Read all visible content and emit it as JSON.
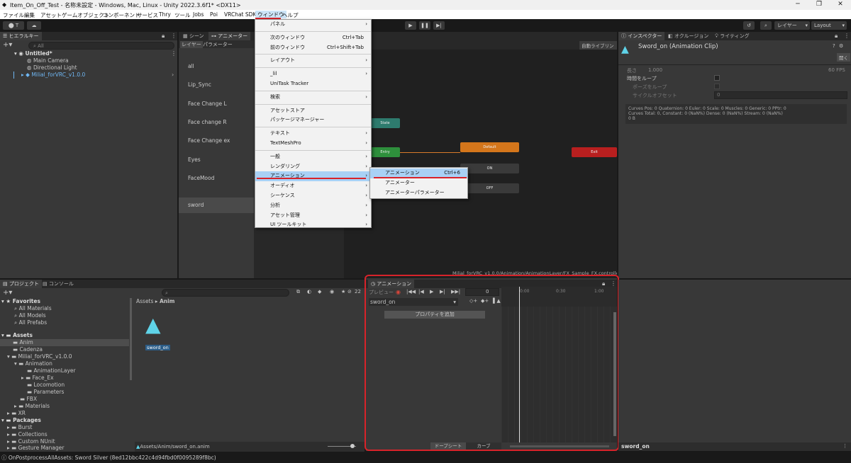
{
  "window": {
    "title": "Item_On_Off_Test - 名称未設定 - Windows, Mac, Linux - Unity 2022.3.6f1* <DX11>",
    "minimize": "─",
    "maximize": "❐",
    "close": "✕"
  },
  "menubar": [
    "ファイル",
    "編集",
    "アセット",
    "ゲームオブジェクト",
    "コンポーネント",
    "サービス",
    "Thry",
    "ツール",
    "Jobs",
    "Poi",
    "VRChat SDK",
    "ウィンドウ",
    "ヘルプ"
  ],
  "toolbar": {
    "account": "T",
    "layers": "レイヤー",
    "layout": "Layout"
  },
  "hierarchy": {
    "tab": "ヒエラルキー",
    "search_placeholder": "All",
    "scene": "Untitled*",
    "items": [
      "Main Camera",
      "Directional Light",
      "Milial_forVRC_v1.0.0"
    ]
  },
  "animator": {
    "tab_scene": "シーン",
    "tab_animator": "アニメーター",
    "subtab_layers": "レイヤー",
    "subtab_params": "パラメーター",
    "layers": [
      "all",
      "Lip_Sync",
      "Face Change L",
      "Face change R",
      "Face Change ex",
      "Eyes",
      "FaceMood",
      "sword"
    ],
    "auto_live_link": "自動ライブリンク",
    "path": "Milial_forVRC_v1.0.0/Animation/AnimationLayer/FX_Sample_FX.controller",
    "nodes": {
      "state": "State",
      "entry": "Entry",
      "default": "Default",
      "on": "ON",
      "off": "OFF",
      "exit": "Exit"
    }
  },
  "window_menu": {
    "items": [
      {
        "label": "パネル",
        "sub": true
      },
      {
        "sep": true
      },
      {
        "label": "次のウィンドウ",
        "shortcut": "Ctrl+Tab"
      },
      {
        "label": "前のウィンドウ",
        "shortcut": "Ctrl+Shift+Tab"
      },
      {
        "sep": true
      },
      {
        "label": "レイアウト",
        "sub": true
      },
      {
        "sep": true
      },
      {
        "label": "_lil",
        "sub": true
      },
      {
        "label": "UniTask Tracker"
      },
      {
        "sep": true
      },
      {
        "label": "検索",
        "sub": true
      },
      {
        "sep": true
      },
      {
        "label": "アセットストア"
      },
      {
        "label": "パッケージマネージャー"
      },
      {
        "sep": true
      },
      {
        "label": "テキスト",
        "sub": true
      },
      {
        "label": "TextMeshPro",
        "sub": true
      },
      {
        "sep": true
      },
      {
        "label": "一般",
        "sub": true
      },
      {
        "label": "レンダリング",
        "sub": true
      },
      {
        "label": "アニメーション",
        "sub": true,
        "highlight": true
      },
      {
        "label": "オーディオ",
        "sub": true
      },
      {
        "label": "シーケンス",
        "sub": true
      },
      {
        "label": "分析",
        "sub": true
      },
      {
        "label": "アセット管理",
        "sub": true
      },
      {
        "label": "UI ツールキット",
        "sub": true
      }
    ]
  },
  "anim_submenu": {
    "items": [
      {
        "label": "アニメーション",
        "shortcut": "Ctrl+6"
      },
      {
        "label": "アニメーター"
      },
      {
        "label": "アニメーターパラメーター"
      }
    ]
  },
  "inspector": {
    "tab_inspector": "インスペクター",
    "tab_occlusion": "オクルージョン",
    "tab_lighting": "ライティング",
    "title": "Sword_on (Animation Clip)",
    "open": "開く",
    "length_label": "長さ",
    "length_value": "1.000",
    "fps": "60 FPS",
    "loop_time": "時間をループ",
    "loop_pose": "ポーズをループ",
    "cycle_offset": "サイクルオフセット",
    "cycle_value": "0",
    "curves1": "Curves Pos: 0 Quaternion: 0 Euler: 0 Scale: 0 Muscles: 0 Generic: 0 PPtr: 0",
    "curves2": "Curves Total: 0, Constant: 0 (NaN%) Dense: 0 (NaN%) Stream: 0 (NaN%)",
    "curves3": "0 B",
    "footer": "sword_on"
  },
  "project": {
    "tab_project": "プロジェクト",
    "tab_console": "コンソール",
    "count": "22",
    "favorites": "Favorites",
    "fav_items": [
      "All Materials",
      "All Models",
      "All Prefabs"
    ],
    "assets": "Assets",
    "tree": [
      "Anim",
      "Cadenza",
      "Milial_forVRC_v1.0.0",
      "Animation",
      "AnimationLayer",
      "Face_Ex",
      "Locomotion",
      "Parameters",
      "FBX",
      "Materials",
      "XR"
    ],
    "packages": "Packages",
    "pkg_items": [
      "Burst",
      "Collections",
      "Custom NUnit",
      "Gesture Manager"
    ],
    "breadcrumb_root": "Assets",
    "breadcrumb_leaf": "Anim",
    "asset_name": "sword_on",
    "footer_path": "Assets/Anim/sword_on.anim"
  },
  "animation": {
    "tab": "アニメーション",
    "preview": "プレビュー",
    "frame": "0",
    "clip": "sword_on",
    "add_property": "プロパティを追加",
    "ticks": [
      "0:00",
      "0:30",
      "1:00"
    ],
    "dopesheet": "ドープシート",
    "curves": "カーブ"
  },
  "status": {
    "text": "OnPostprocessAllAssets: Sword Silver (8ed12bbc422c4d94fbd0f0095289f8bc)"
  }
}
